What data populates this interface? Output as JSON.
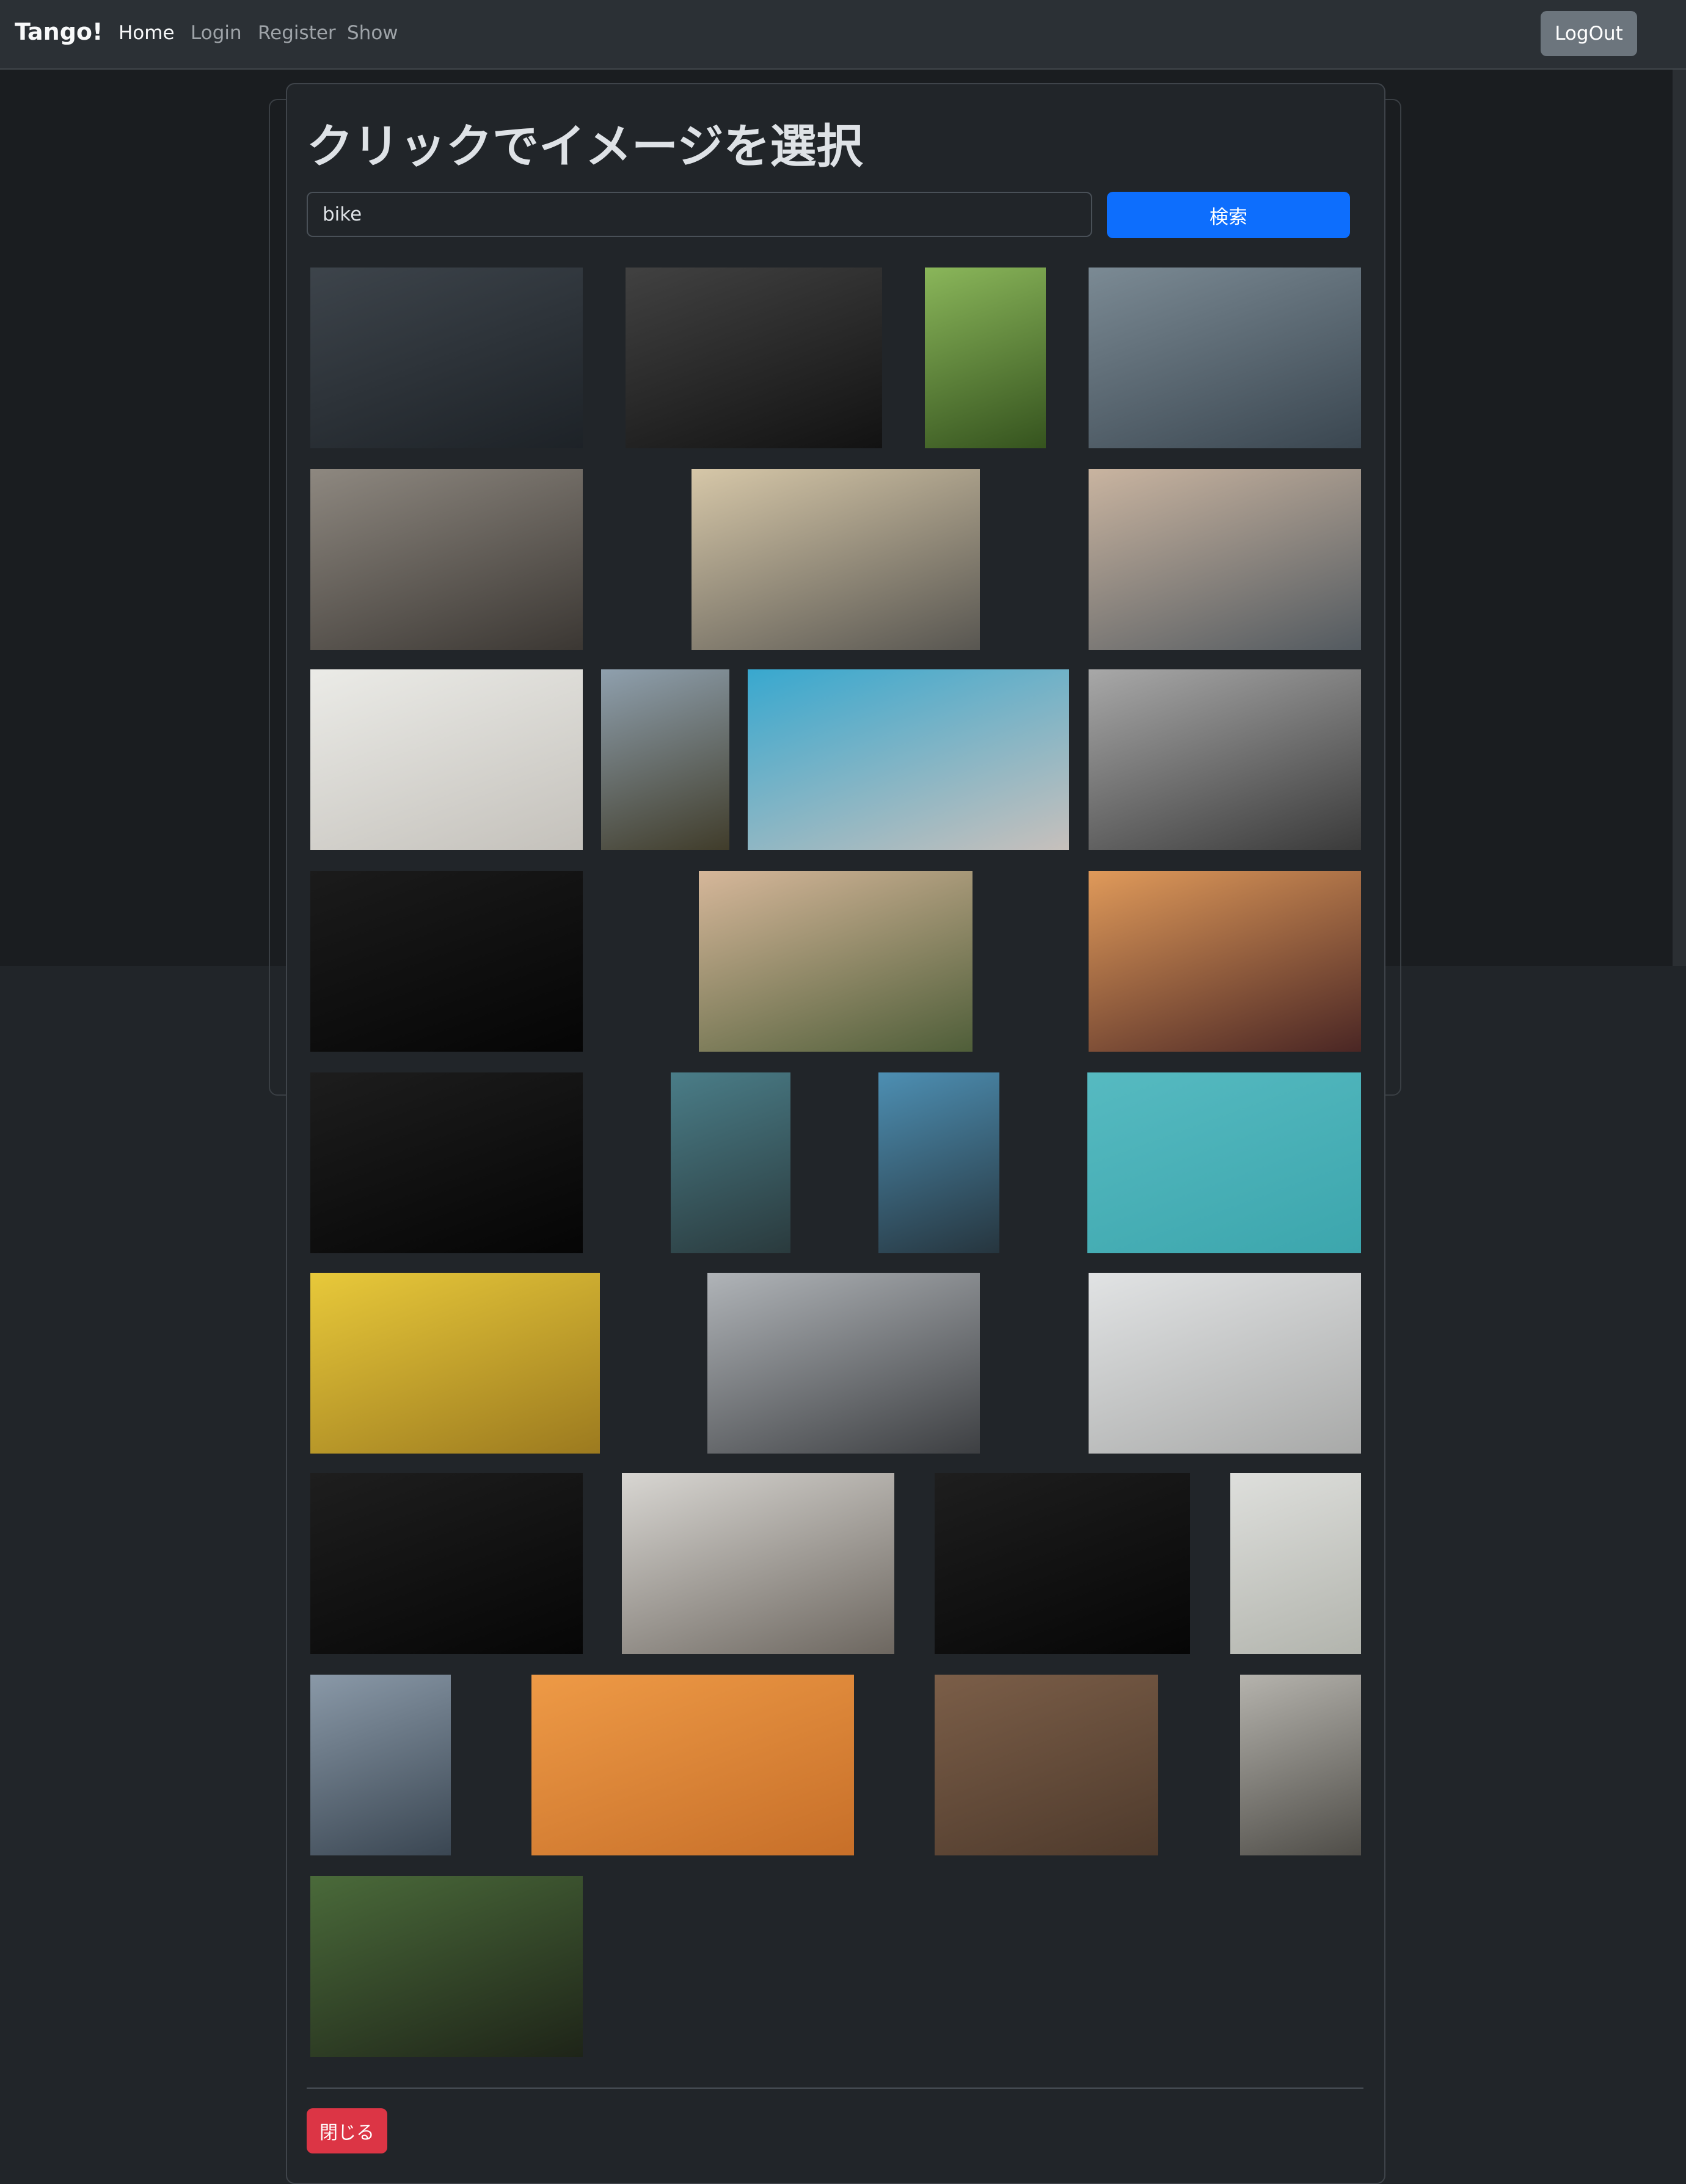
{
  "navbar": {
    "brand": "Tango!",
    "links": [
      "Home",
      "Login",
      "Register",
      "Show"
    ],
    "logout_label": "LogOut"
  },
  "modal": {
    "title": "クリックでイメージを選択",
    "search_value": "bike",
    "search_button": "検索",
    "close_button": "閉じる"
  },
  "images": [
    {
      "name": "bike-photo-white-bicycle-dark-wall",
      "colors": [
        "#3d444b",
        "#1d2227"
      ]
    },
    {
      "name": "bike-photo-black-road-bike",
      "colors": [
        "#414141",
        "#121212"
      ]
    },
    {
      "name": "bike-photo-cyclist-green-cliff",
      "colors": [
        "#8ab65a",
        "#35531e"
      ]
    },
    {
      "name": "bike-photo-black-motorcycle",
      "colors": [
        "#7b8a94",
        "#3a4650"
      ]
    },
    {
      "name": "bike-photo-woman-riding-street",
      "colors": [
        "#8e8880",
        "#3b3733"
      ]
    },
    {
      "name": "bike-photo-cyclist-yellow-wheels",
      "colors": [
        "#d6c7a8",
        "#585651"
      ]
    },
    {
      "name": "bike-photo-city-bike-closeup",
      "colors": [
        "#c9b4a0",
        "#535a60"
      ]
    },
    {
      "name": "bike-photo-orange-wheel-bike-white-wall",
      "colors": [
        "#ebebe7",
        "#c4c1bb"
      ]
    },
    {
      "name": "bike-photo-mountain-bike-cliff",
      "colors": [
        "#8fa0ae",
        "#403c2a"
      ]
    },
    {
      "name": "bike-photo-white-bike-blue-wall",
      "colors": [
        "#38a8cf",
        "#c7c0bc"
      ]
    },
    {
      "name": "bike-photo-blurred-cyclists",
      "colors": [
        "#a8a8a8",
        "#3a3a3a"
      ]
    },
    {
      "name": "bike-photo-dark-handlebar-1",
      "colors": [
        "#1b1b1b",
        "#050505"
      ]
    },
    {
      "name": "bike-photo-cyclist-hill-road",
      "colors": [
        "#d6b79a",
        "#4f5e39"
      ]
    },
    {
      "name": "bike-photo-sunset-handlebar-red",
      "colors": [
        "#e09a5a",
        "#4a2624"
      ]
    },
    {
      "name": "bike-photo-dark-handlebar-2",
      "colors": [
        "#1d1d1d",
        "#050505"
      ]
    },
    {
      "name": "bike-photo-cyclist-red-shirt",
      "colors": [
        "#4a7d88",
        "#2a3a3d"
      ]
    },
    {
      "name": "bike-photo-rider-sky-view",
      "colors": [
        "#4d8fb3",
        "#26353e"
      ]
    },
    {
      "name": "bike-photo-red-wheel-teal-wall",
      "colors": [
        "#56bac1",
        "#3ca6ad"
      ]
    },
    {
      "name": "bike-photo-yellow-wall-basket-bike",
      "colors": [
        "#e8c93a",
        "#9c7a1f"
      ]
    },
    {
      "name": "bike-photo-cassette-gears",
      "colors": [
        "#b0b4b8",
        "#3d3f42"
      ]
    },
    {
      "name": "bike-photo-white-bike-bright-room",
      "colors": [
        "#e1e3e4",
        "#a8a9a8"
      ]
    },
    {
      "name": "bike-photo-dark-handlebar-3",
      "colors": [
        "#1e1e1e",
        "#060606"
      ]
    },
    {
      "name": "bike-photo-two-cyclists-beach",
      "colors": [
        "#d8d6d2",
        "#6d6760"
      ]
    },
    {
      "name": "bike-photo-dark-handlebar-4",
      "colors": [
        "#1e1e1e",
        "#060606"
      ]
    },
    {
      "name": "bike-photo-bike-grey-studio",
      "colors": [
        "#dedfdc",
        "#b2b4ad"
      ]
    },
    {
      "name": "bike-photo-blurred-city-cyclist",
      "colors": [
        "#8a99a8",
        "#3a4652"
      ]
    },
    {
      "name": "bike-photo-teal-bike-orange-wall",
      "colors": [
        "#ee9a46",
        "#c76f29"
      ]
    },
    {
      "name": "bike-photo-heart-bike-sign",
      "colors": [
        "#7b5e48",
        "#4e3a2c"
      ]
    },
    {
      "name": "bike-photo-parked-bikes",
      "colors": [
        "#b5b3ad",
        "#4f4d48"
      ]
    },
    {
      "name": "bike-photo-forest-trail-bike",
      "colors": [
        "#4a6a3a",
        "#1e2418"
      ]
    }
  ]
}
